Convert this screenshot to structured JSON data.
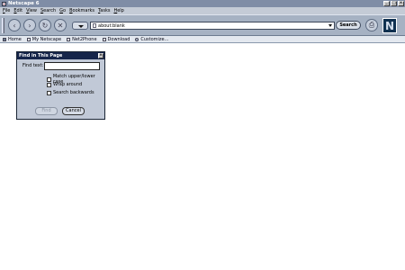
{
  "window": {
    "title": "Netscape 6",
    "controls": [
      "_",
      "□",
      "×"
    ]
  },
  "menu": {
    "items": [
      {
        "label": "File",
        "underline": "F"
      },
      {
        "label": "Edit",
        "underline": "E"
      },
      {
        "label": "View",
        "underline": "V"
      },
      {
        "label": "Search",
        "underline": "S"
      },
      {
        "label": "Go",
        "underline": "G"
      },
      {
        "label": "Bookmarks",
        "underline": "B"
      },
      {
        "label": "Tasks",
        "underline": "T"
      },
      {
        "label": "Help",
        "underline": "H"
      }
    ]
  },
  "navbar": {
    "back_glyph": "‹",
    "forward_glyph": "›",
    "reload_glyph": "↻",
    "stop_glyph": "✕",
    "url": "about:blank",
    "search_label": "Search",
    "logo_letter": "N"
  },
  "bookmarks": [
    {
      "label": "Home",
      "icon": "home-icon"
    },
    {
      "label": "My Netscape",
      "icon": "bookmark-icon"
    },
    {
      "label": "Net2Phone",
      "icon": "bookmark-icon"
    },
    {
      "label": "Download",
      "icon": "bookmark-icon"
    },
    {
      "label": "Customize...",
      "icon": "customize-icon"
    }
  ],
  "find_dialog": {
    "title": "Find in This Page",
    "close_glyph": "×",
    "find_text_label": "Find text:",
    "find_text_value": "",
    "options": [
      {
        "label": "Match upper/lower case",
        "checked": false
      },
      {
        "label": "Wrap around",
        "checked": false
      },
      {
        "label": "Search backwards",
        "checked": false
      }
    ],
    "find_button": "Find",
    "cancel_button": "Cancel"
  }
}
